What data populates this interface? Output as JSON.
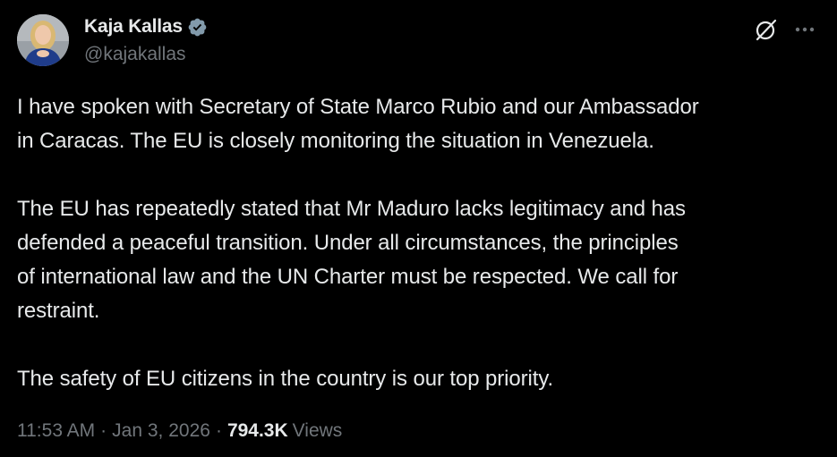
{
  "author": {
    "display_name": "Kaja Kallas",
    "handle": "@kajakallas",
    "verified": true,
    "verified_color": "#829aab"
  },
  "icons": {
    "verified": "verified-badge-icon",
    "grok": "grok-icon",
    "more": "more-options-icon"
  },
  "tweet": {
    "lines": [
      "I have spoken with Secretary of State Marco Rubio and our Ambassador",
      "in Caracas. The EU is closely monitoring the situation in Venezuela.",
      "",
      "The EU has repeatedly stated that Mr Maduro lacks legitimacy and has",
      "defended a peaceful transition. Under all circumstances, the principles",
      "of international law and the UN Charter must be respected. We call for",
      "restraint.",
      "",
      "The safety of EU citizens in the country is our top priority."
    ],
    "time": "11:53 AM",
    "separator": "·",
    "date": "Jan 3, 2026",
    "views_count": "794.3K",
    "views_label": "Views"
  },
  "colors": {
    "background": "#000000",
    "text": "#e7e9ea",
    "secondary": "#71767b"
  }
}
